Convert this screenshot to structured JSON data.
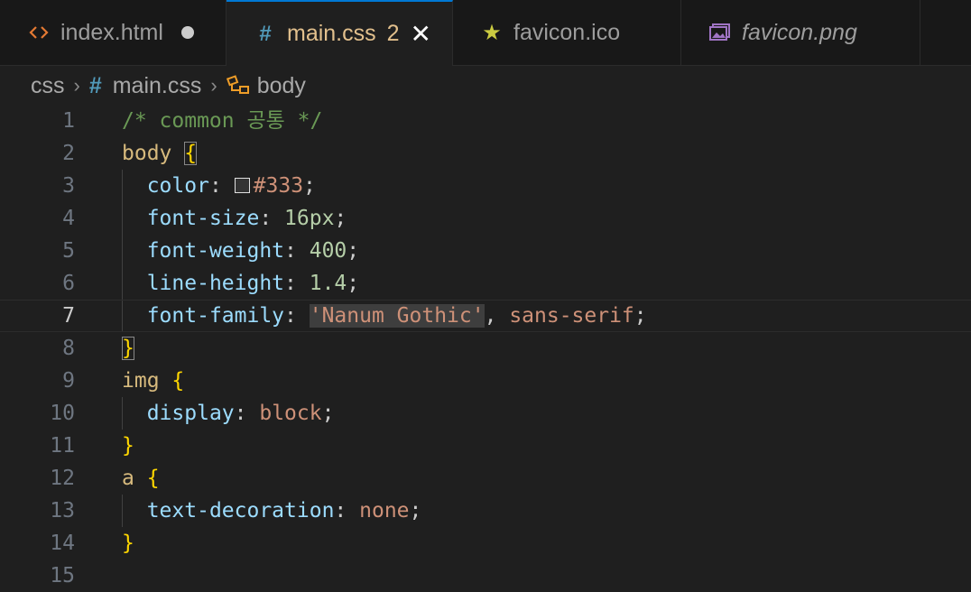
{
  "tabs": [
    {
      "icon": "code-brackets-icon",
      "label": "index.html",
      "italic": false,
      "modified": true,
      "active": false
    },
    {
      "icon": "css-hash-icon",
      "label": "main.css",
      "badge": "2",
      "active": true,
      "closable": true
    },
    {
      "icon": "star-icon",
      "label": "favicon.ico",
      "italic": false,
      "active": false
    },
    {
      "icon": "image-icon",
      "label": "favicon.png",
      "italic": true,
      "active": false
    }
  ],
  "breadcrumb": [
    "css",
    "main.css",
    "body"
  ],
  "colors": {
    "accent": "#0078d4",
    "modified": "#e2c08d",
    "swatch": "#333333"
  },
  "lines": [
    {
      "n": "1",
      "tokens": [
        [
          "c-comment",
          "/* common 공통 */"
        ]
      ]
    },
    {
      "n": "2",
      "tokens": [
        [
          "c-sel",
          "body "
        ],
        [
          "c-brace",
          "{"
        ]
      ]
    },
    {
      "n": "3",
      "tokens": [
        [
          "c-punc",
          "  "
        ],
        [
          "c-prop",
          "color"
        ],
        [
          "c-punc",
          ": "
        ],
        [
          "swatch",
          ""
        ],
        [
          "c-val",
          "#333"
        ],
        [
          "c-punc",
          ";"
        ]
      ]
    },
    {
      "n": "4",
      "tokens": [
        [
          "c-punc",
          "  "
        ],
        [
          "c-prop",
          "font-size"
        ],
        [
          "c-punc",
          ": "
        ],
        [
          "c-num",
          "16px"
        ],
        [
          "c-punc",
          ";"
        ]
      ]
    },
    {
      "n": "5",
      "tokens": [
        [
          "c-punc",
          "  "
        ],
        [
          "c-prop",
          "font-weight"
        ],
        [
          "c-punc",
          ": "
        ],
        [
          "c-num",
          "400"
        ],
        [
          "c-punc",
          ";"
        ]
      ]
    },
    {
      "n": "6",
      "tokens": [
        [
          "c-punc",
          "  "
        ],
        [
          "c-prop",
          "line-height"
        ],
        [
          "c-punc",
          ": "
        ],
        [
          "c-num",
          "1.4"
        ],
        [
          "c-punc",
          ";"
        ]
      ]
    },
    {
      "n": "7",
      "current": true,
      "tokens": [
        [
          "c-punc",
          "  "
        ],
        [
          "c-prop",
          "font-family"
        ],
        [
          "c-punc",
          ": "
        ],
        [
          "c-str",
          "'Nanum Gothic'"
        ],
        [
          "c-punc",
          ", "
        ],
        [
          "c-val",
          "sans-serif"
        ],
        [
          "c-punc",
          ";"
        ]
      ]
    },
    {
      "n": "8",
      "tokens": [
        [
          "c-brace",
          "}"
        ]
      ]
    },
    {
      "n": "9",
      "tokens": [
        [
          "c-sel",
          "img "
        ],
        [
          "c-brace",
          "{"
        ]
      ]
    },
    {
      "n": "10",
      "tokens": [
        [
          "c-punc",
          "  "
        ],
        [
          "c-prop",
          "display"
        ],
        [
          "c-punc",
          ": "
        ],
        [
          "c-val",
          "block"
        ],
        [
          "c-punc",
          ";"
        ]
      ]
    },
    {
      "n": "11",
      "tokens": [
        [
          "c-brace",
          "}"
        ]
      ]
    },
    {
      "n": "12",
      "tokens": [
        [
          "c-sel",
          "a "
        ],
        [
          "c-brace",
          "{"
        ]
      ]
    },
    {
      "n": "13",
      "tokens": [
        [
          "c-punc",
          "  "
        ],
        [
          "c-prop",
          "text-decoration"
        ],
        [
          "c-punc",
          ": "
        ],
        [
          "c-val",
          "none"
        ],
        [
          "c-punc",
          ";"
        ]
      ]
    },
    {
      "n": "14",
      "tokens": [
        [
          "c-brace",
          "}"
        ]
      ]
    },
    {
      "n": "15",
      "tokens": []
    }
  ]
}
